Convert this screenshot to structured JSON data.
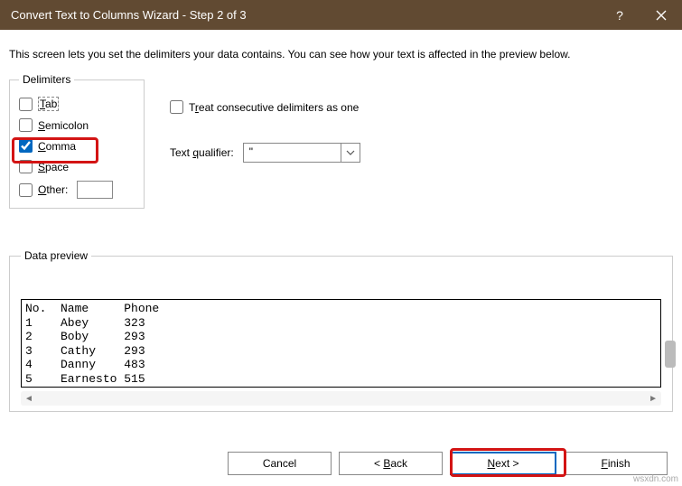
{
  "titlebar": {
    "title": "Convert Text to Columns Wizard - Step 2 of 3"
  },
  "desc": "This screen lets you set the delimiters your data contains.  You can see how your text is affected in the preview below.",
  "delimiters": {
    "legend": "Delimiters",
    "tab": "Tab",
    "semicolon": "Semicolon",
    "comma": "Comma",
    "space": "Space",
    "other": "Other:",
    "consecutive": "Treat consecutive delimiters as one",
    "qualifier_label": "Text qualifier:",
    "qualifier_value": "\""
  },
  "preview": {
    "legend": "Data preview",
    "header": {
      "c1": "No.",
      "c2": "Name",
      "c3": "Phone"
    },
    "rows": [
      {
        "c1": "1",
        "c2": "Abey",
        "c3": "323"
      },
      {
        "c1": "2",
        "c2": "Boby",
        "c3": "293"
      },
      {
        "c1": "3",
        "c2": "Cathy",
        "c3": "293"
      },
      {
        "c1": "4",
        "c2": "Danny",
        "c3": "483"
      },
      {
        "c1": "5",
        "c2": "Earnesto",
        "c3": "515"
      }
    ]
  },
  "buttons": {
    "cancel": "Cancel",
    "back": "< Back",
    "next": "Next >",
    "finish": "Finish"
  },
  "watermark": "wsxdn.com"
}
